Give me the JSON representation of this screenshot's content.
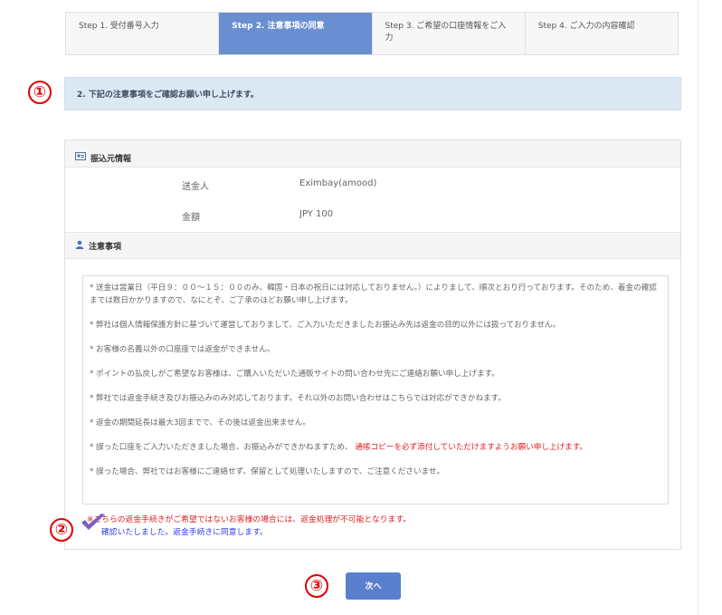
{
  "steps": [
    {
      "label": "Step 1. 受付番号入力",
      "active": false
    },
    {
      "label": "Step 2. 注意事項の同意",
      "active": true
    },
    {
      "label": "Step 3. ご希望の口座情報をご入力",
      "active": false
    },
    {
      "label": "Step 4. ご入力の内容確認",
      "active": false
    }
  ],
  "markers": [
    "①",
    "②",
    "③"
  ],
  "banner": "2. 下記の注意事項をご確認お願い申し上げます。",
  "sender_section": {
    "title": "振込元情報",
    "icon": "id-card-icon",
    "rows": [
      {
        "label": "送金人",
        "value": "Eximbay(amood)"
      },
      {
        "label": "金額",
        "value": "JPY 100"
      }
    ]
  },
  "notes_section": {
    "title": "注意事項",
    "icon": "user-icon",
    "notes": [
      "* 送金は営業日（平日９：００～１５：００のみ、韓国・日本の祝日には対応しておりません。）によりまして、順次とおり行っております。そのため、着金の確認までは数日かかりますので、なにとぞ、ご了承のほどお願い申し上げます。",
      "* 弊社は個人情報保護方針に基づいて運営しておりまして、ご入力いただきましたお振込み先は返金の目的以外には扱っておりません。",
      "* お客様の名義以外の口座座では返金ができません。",
      "* ポイントの払戻しがご希望なお客様は、ご購入いただいた通販サイトの問い合わせ先にご連絡お願い申し上げます。",
      "* 弊社では返金手続き及びお振込みのみ対応しております。それ以外のお問い合わせはこちらでは対応ができかねます。",
      "* 返金の期間延長は最大3回までで、その後は返金出来ません。"
    ],
    "note7_black": "* 誤った口座をご入力いただきました場合、お振込みができかねますため、",
    "note7_red": "通帳コピーを必ず添付していただけますようお願い申し上げます。",
    "note8": "* 誤った場合、弊社ではお客様にご連絡せず、保留として処理いたしますので、ご注意くださいませ。"
  },
  "warning_text": "※こちらの返金手続きがご希望ではないお客様の場合には、返金処理が不可能となります。",
  "agree_text": "確認いたしました。返金手続きに同意します。",
  "next_button": "次へ",
  "colors": {
    "active_step": "#6a8fd0",
    "banner_bg": "#dce9f5",
    "warning": "#e02020",
    "agree": "#2a3fd8",
    "button": "#5b7fcf",
    "marker": "#e00000",
    "checkmark": "#7a5fc0"
  }
}
